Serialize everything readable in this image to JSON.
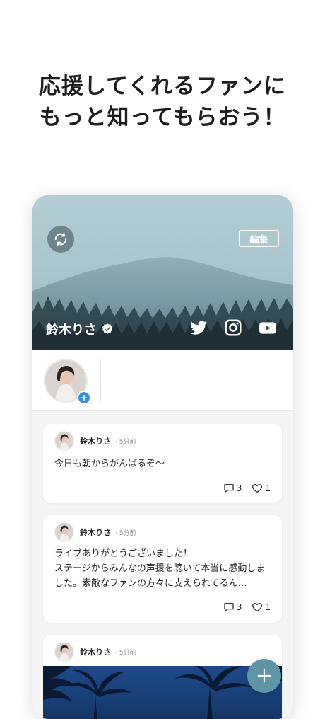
{
  "headline": {
    "line1": "応援してくれるファンに",
    "line2": "もっと知ってもらおう！"
  },
  "profile": {
    "name": "鈴木りさ",
    "edit_label": "編集",
    "verified_icon": "verified-badge-icon",
    "social": [
      "twitter-icon",
      "instagram-icon",
      "youtube-icon"
    ]
  },
  "posts": [
    {
      "author": "鈴木りさ",
      "time": "· 5分前",
      "text": "今日も朝からがんばるぞ〜",
      "comments": "3",
      "likes": "1"
    },
    {
      "author": "鈴木りさ",
      "time": "· 5分前",
      "text": "ライブありがとうございました！\nステージからみんなの声援を聴いて本当に感動しました。素敵なファンの方々に支えられてるん…",
      "comments": "3",
      "likes": "1"
    },
    {
      "author": "鈴木りさ",
      "time": "· 5分前"
    }
  ],
  "colors": {
    "accent_blue": "#3a8fe0",
    "fab": "#5f95a6"
  }
}
